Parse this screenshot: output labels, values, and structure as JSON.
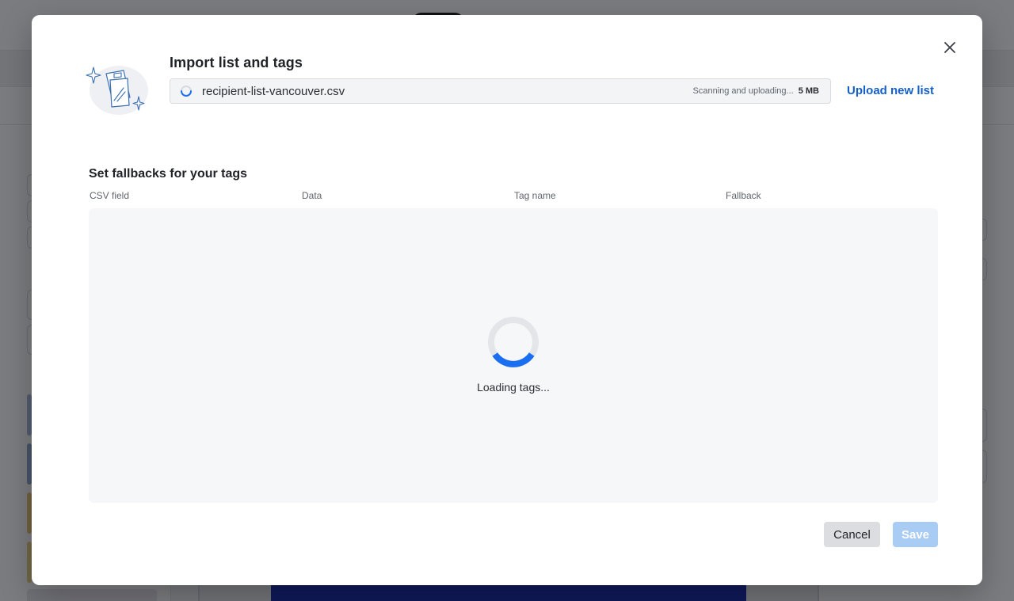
{
  "modal": {
    "title": "Import list and tags",
    "file": {
      "name": "recipient-list-vancouver.csv",
      "status": "Scanning and uploading...",
      "size": "5 MB"
    },
    "upload_new_label": "Upload new list",
    "section_title": "Set fallbacks for your tags",
    "columns": [
      "CSV field",
      "Data",
      "Tag name",
      "Fallback"
    ],
    "loading_text": "Loading tags...",
    "buttons": {
      "cancel": "Cancel",
      "save": "Save"
    }
  },
  "icons": {
    "close": "close-icon",
    "illustration": "documents-sparkle-illustration",
    "file_spinner": "loading-spinner-icon",
    "tags_spinner": "loading-spinner-icon"
  },
  "colors": {
    "accent": "#1460c8",
    "spinner_active": "#1a6ff0",
    "spinner_track": "#e3e5e8",
    "save_disabled": "#a9ccf5",
    "cancel_bg": "#dcdde0",
    "overlay": "#14161a"
  }
}
